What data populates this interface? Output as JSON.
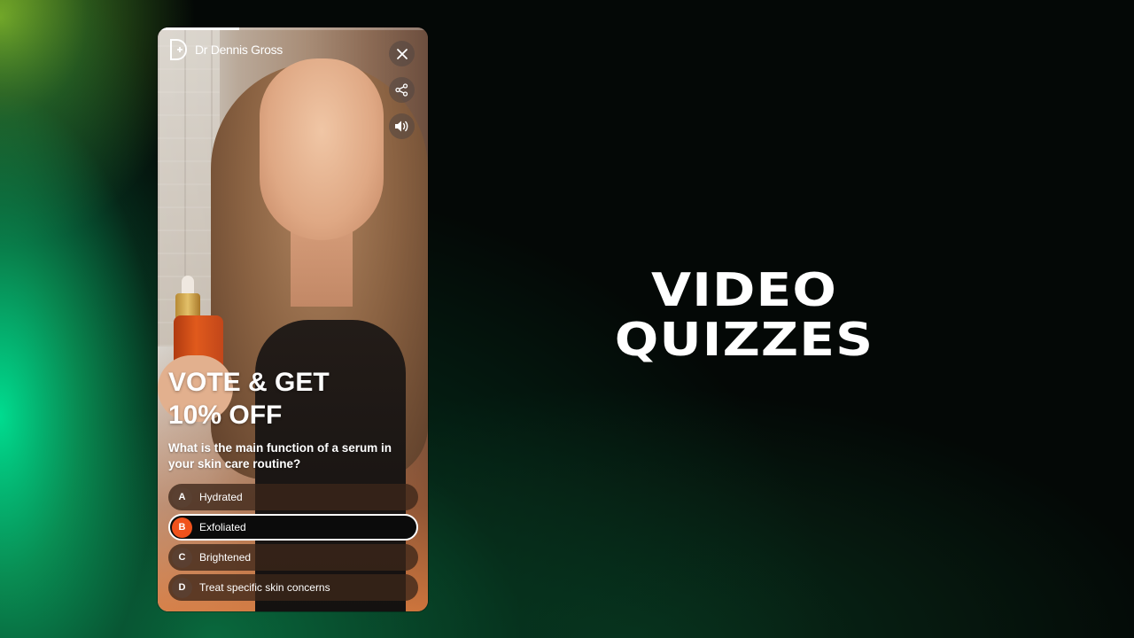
{
  "colors": {
    "accent": "#f0521c",
    "selected_option_bg": "#0b0b0b",
    "text": "#ffffff"
  },
  "story": {
    "progress_percent": 30,
    "brand": {
      "logo_icon": "dr-dennis-gross-logo-icon",
      "name": "Dr Dennis Gross"
    },
    "controls": [
      {
        "icon": "close-icon"
      },
      {
        "icon": "share-icon"
      },
      {
        "icon": "volume-icon"
      }
    ]
  },
  "quiz": {
    "title_line1": "VOTE & GET",
    "title_line2": "10% OFF",
    "question": "What is the main function of a serum in your skin care routine?",
    "options": [
      {
        "letter": "A",
        "label": "Hydrated",
        "selected": false
      },
      {
        "letter": "B",
        "label": "Exfoliated",
        "selected": true
      },
      {
        "letter": "C",
        "label": "Brightened",
        "selected": false
      },
      {
        "letter": "D",
        "label": "Treat specific skin concerns",
        "selected": false
      }
    ]
  },
  "headline": {
    "line1": "VIDEO",
    "line2": "QUIZZES"
  }
}
